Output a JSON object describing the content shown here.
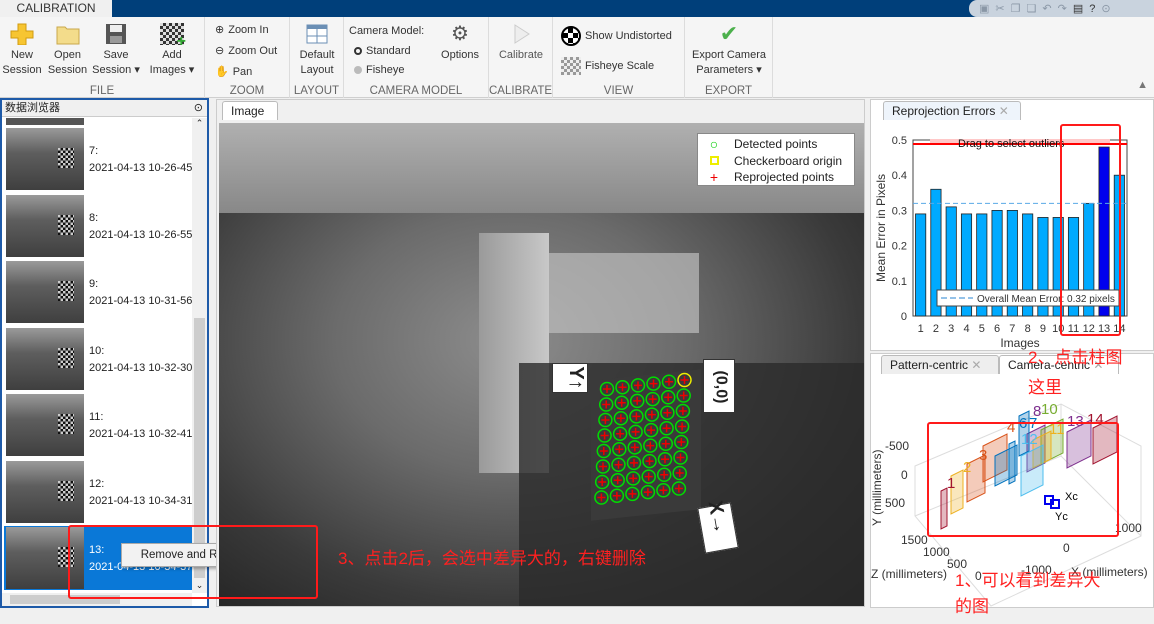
{
  "app": {
    "tab": "CALIBRATION"
  },
  "ribbon": {
    "file": {
      "label": "FILE",
      "new_session": [
        "New",
        "Session"
      ],
      "open_session": [
        "Open",
        "Session"
      ],
      "save_session": [
        "Save",
        "Session ▾"
      ],
      "add_images": [
        "Add",
        "Images ▾"
      ]
    },
    "zoom": {
      "label": "ZOOM",
      "zoom_in": "Zoom In",
      "zoom_out": "Zoom Out",
      "pan": "Pan"
    },
    "layout": {
      "label": "LAYOUT",
      "default_layout": [
        "Default",
        "Layout"
      ]
    },
    "camera_model": {
      "label": "CAMERA MODEL",
      "title": "Camera Model:",
      "standard": "Standard",
      "fisheye": "Fisheye",
      "options": "Options",
      "selected": "Standard"
    },
    "calibrate": {
      "label": "CALIBRATE",
      "calibrate": "Calibrate"
    },
    "view": {
      "label": "VIEW",
      "show_undistorted": "Show Undistorted",
      "fisheye_scale": "Fisheye Scale"
    },
    "export": {
      "label": "EXPORT",
      "export": [
        "Export Camera",
        "Parameters ▾"
      ]
    }
  },
  "browser": {
    "title": "数据浏览器",
    "items": [
      {
        "n": "7:",
        "d": "2021-04-13 10-26-45"
      },
      {
        "n": "8:",
        "d": "2021-04-13 10-26-55"
      },
      {
        "n": "9:",
        "d": "2021-04-13 10-31-56"
      },
      {
        "n": "10:",
        "d": "2021-04-13 10-32-30"
      },
      {
        "n": "11:",
        "d": "2021-04-13 10-32-41"
      },
      {
        "n": "12:",
        "d": "2021-04-13 10-34-31"
      },
      {
        "n": "13:",
        "d": "2021-04-13 10-34-37",
        "selected": true
      }
    ],
    "context_menu": "Remove and Recalibrate"
  },
  "image_panel": {
    "tab": "Image",
    "legend": [
      "Detected points",
      "Checkerboard origin",
      "Reprojected points"
    ],
    "axis_y": "Y↑",
    "axis_x": "X→",
    "origin": "(0,0)"
  },
  "reprojection": {
    "tab": "Reprojection Errors",
    "chart_data": {
      "type": "bar",
      "categories": [
        "1",
        "2",
        "3",
        "4",
        "5",
        "6",
        "7",
        "8",
        "9",
        "10",
        "11",
        "12",
        "13",
        "14"
      ],
      "values": [
        0.29,
        0.36,
        0.31,
        0.29,
        0.29,
        0.3,
        0.3,
        0.29,
        0.28,
        0.28,
        0.28,
        0.32,
        0.48,
        0.4
      ],
      "selected": "13",
      "xlabel": "Images",
      "ylabel": "Mean Error in Pixels",
      "ylim": [
        0,
        0.5
      ],
      "yticks": [
        "0",
        "0.1",
        "0.2",
        "0.3",
        "0.4",
        "0.5"
      ],
      "mean": 0.32,
      "mean_label": "Overall Mean Error: 0.32 pixels",
      "drag_label": "Drag to select outliers",
      "colors": {
        "bar": "#00aaff",
        "selected": "#0000ee",
        "threshold": "#ff0000"
      }
    }
  },
  "extrinsics": {
    "tabs": [
      "Pattern-centric",
      "Camera-centric"
    ],
    "active": "Camera-centric",
    "yticks": [
      "-500",
      "0",
      "500"
    ],
    "zticks": [
      "1500",
      "1000",
      "500",
      "0"
    ],
    "xticks": [
      "1000",
      "0",
      "-1000"
    ],
    "ylabel": "Y (millimeters)",
    "zlabel": "Z (millimeters)",
    "xlabel": "X (millimeters)",
    "cam_labels": [
      "Xc",
      "Yc"
    ],
    "board_labels": [
      "1",
      "2",
      "3",
      "4",
      "6",
      "7",
      "8",
      "10",
      "11",
      "12",
      "13",
      "14"
    ]
  },
  "annotations": {
    "a1": "1、可以看到差异大",
    "a1b": "的图",
    "a2": "2、点击柱图",
    "a2b": "这里",
    "a3": "3、点击2后，会选中差异大的，右键删除"
  }
}
